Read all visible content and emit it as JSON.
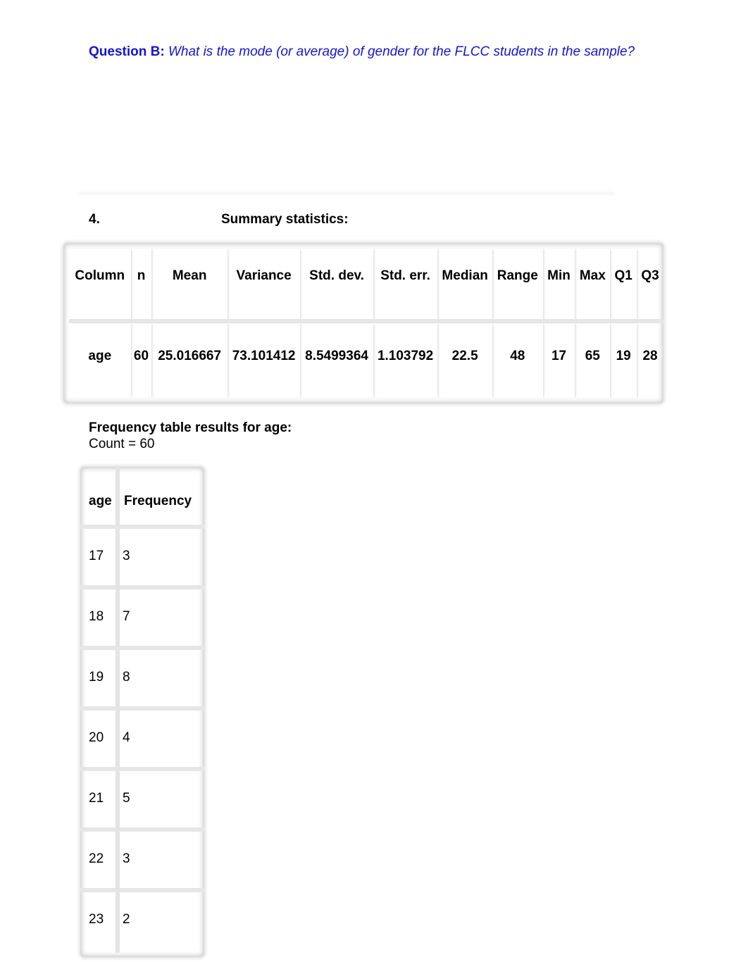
{
  "question": {
    "label": "Question B:",
    "text": " What is the mode (or average) of gender for the FLCC students in the sample?",
    "color": "#1414d2"
  },
  "section": {
    "number": "4.",
    "title": "Summary statistics:"
  },
  "summary_table": {
    "headers": [
      "Column",
      "n",
      "Mean",
      "Variance",
      "Std. dev.",
      "Std. err.",
      "Median",
      "Range",
      "Min",
      "Max",
      "Q1",
      "Q3"
    ],
    "rows": [
      [
        "age",
        "60",
        "25.016667",
        "73.101412",
        "8.5499364",
        "1.103792",
        "22.5",
        "48",
        "17",
        "65",
        "19",
        "28"
      ]
    ]
  },
  "frequency": {
    "title": "Frequency table results for age:",
    "count_text": "Count = 60",
    "headers": [
      "age",
      "Frequency"
    ],
    "rows": [
      [
        "17",
        "3"
      ],
      [
        "18",
        "7"
      ],
      [
        "19",
        "8"
      ],
      [
        "20",
        "4"
      ],
      [
        "21",
        "5"
      ],
      [
        "22",
        "3"
      ],
      [
        "23",
        "2"
      ]
    ]
  }
}
